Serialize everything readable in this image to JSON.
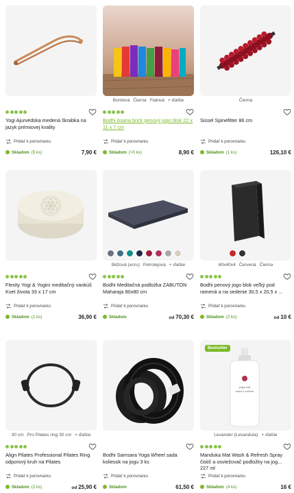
{
  "compare_label": "Pridať k porovnaniu",
  "stock_label": "Skladom",
  "price_prefix": "od",
  "products": [
    {
      "title": "Yogi Ajurvédska medená škrabka na jazyk prémiovej kvality",
      "variants": [],
      "stock_count": "(5 ks)",
      "price": "7,90 €",
      "price_from": false,
      "image": "copper-tongue-scraper"
    },
    {
      "title": "Bodhi Asana brick penový jogo blok 22 x 11 x 7 cm",
      "variants": [
        "Bordová",
        "Čierna",
        "Fialová",
        "+ ďalšie"
      ],
      "stock_count": "(>5 ks)",
      "price": "8,90 €",
      "price_from": false,
      "image": "colorful-foam-blocks"
    },
    {
      "title": "Sissel Spinefitter 86 cm",
      "variants": [
        "Čierna"
      ],
      "stock_count": "(1 ks)",
      "price": "126,10 €",
      "price_from": false,
      "image": "spinefitter-roller"
    },
    {
      "title": "Flexity Yogi & Yogini meditačný vankúš Kvet života 33 x 17 cm",
      "variants": [],
      "stock_count": "(1 ks)",
      "price": "36,90 €",
      "price_from": false,
      "image": "meditation-cushion-flower-of-life"
    },
    {
      "title": "Bodhi Meditačná podložka ZABUTON Maharaja 80x80 cm",
      "variants": [
        "Béžová (ecru)",
        "Petrolejová",
        "+ ďalšie"
      ],
      "stock_count": "",
      "price": "70,30 €",
      "price_from": true,
      "image": "zabuton-mat",
      "swatch_colors": [
        "#6b7280",
        "#3f6f86",
        "#0f8f8a",
        "#1e2a4a",
        "#9b1c3b",
        "#b0305c",
        "#a8a8a8",
        "#d8cfc0"
      ]
    },
    {
      "title": "Bodhi penový jogo blok veľký pod ramená a na sedenie 30,5 x 20,5 x ...",
      "variants": [
        "60x40x4",
        "Červená",
        "Čierna"
      ],
      "stock_count": "(2 ks)",
      "price": "10 €",
      "price_from": true,
      "image": "large-foam-block",
      "swatch_colors": [
        "#c62828",
        "#333333"
      ]
    },
    {
      "title": "Align Pilates Professional Pilates Ring odporový kruh na Pilates",
      "variants": [
        "30 cm",
        "Pro Pilates ring 30 cm",
        "+ ďalšie"
      ],
      "stock_count": "(2 ks)",
      "price": "25,90 €",
      "price_from": true,
      "image": "pilates-ring"
    },
    {
      "title": "Bodhi Samsara Yoga Wheel sada koliesok na jogu 3 ks",
      "variants": [],
      "stock_count": "",
      "price": "61,50 €",
      "price_from": false,
      "image": "yoga-wheels"
    },
    {
      "title": "Manduka Mat Wash & Refresh Spray čistič a osviežovač podložky na jog... 227 ml",
      "variants": [
        "Levander (Levandula)",
        "+ ďalšie"
      ],
      "stock_count": "(4 ks)",
      "price": "16 €",
      "price_from": false,
      "image": "mat-wash-spray",
      "badge": "Bestseller",
      "spray_label_lines": [
        "yoga mat",
        "wash & refresh"
      ]
    }
  ]
}
